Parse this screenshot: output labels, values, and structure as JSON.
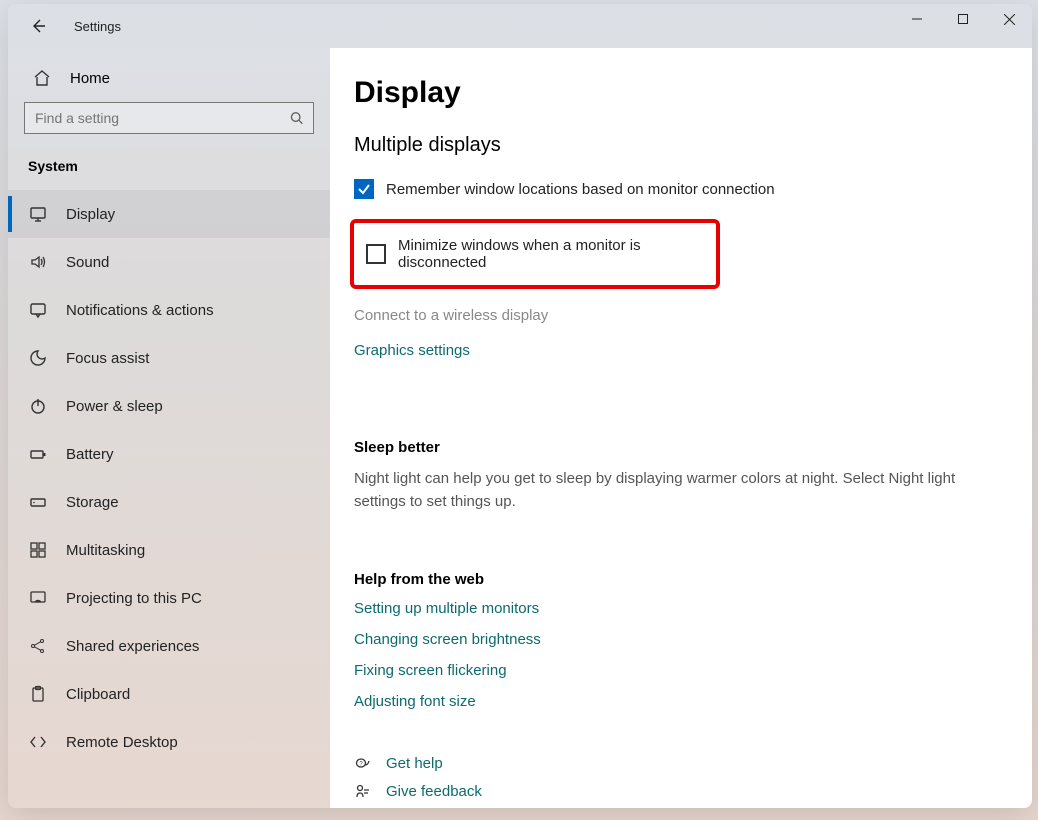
{
  "window": {
    "title": "Settings"
  },
  "home": {
    "label": "Home"
  },
  "search": {
    "placeholder": "Find a setting"
  },
  "category": "System",
  "sidebar": {
    "items": [
      {
        "label": "Display",
        "icon": "display-icon",
        "selected": true
      },
      {
        "label": "Sound",
        "icon": "sound-icon"
      },
      {
        "label": "Notifications & actions",
        "icon": "notifications-icon"
      },
      {
        "label": "Focus assist",
        "icon": "focus-assist-icon"
      },
      {
        "label": "Power & sleep",
        "icon": "power-icon"
      },
      {
        "label": "Battery",
        "icon": "battery-icon"
      },
      {
        "label": "Storage",
        "icon": "storage-icon"
      },
      {
        "label": "Multitasking",
        "icon": "multitasking-icon"
      },
      {
        "label": "Projecting to this PC",
        "icon": "projecting-icon"
      },
      {
        "label": "Shared experiences",
        "icon": "shared-icon"
      },
      {
        "label": "Clipboard",
        "icon": "clipboard-icon"
      },
      {
        "label": "Remote Desktop",
        "icon": "remote-icon"
      }
    ]
  },
  "page": {
    "title": "Display",
    "section_multiple": "Multiple displays",
    "cb_remember": "Remember window locations based on monitor connection",
    "cb_minimize": "Minimize windows when a monitor is disconnected",
    "link_wireless": "Connect to a wireless display",
    "link_graphics": "Graphics settings",
    "sleep_h": "Sleep better",
    "sleep_body": "Night light can help you get to sleep by displaying warmer colors at night. Select Night light settings to set things up.",
    "help_h": "Help from the web",
    "help_links": [
      "Setting up multiple monitors",
      "Changing screen brightness",
      "Fixing screen flickering",
      "Adjusting font size"
    ],
    "get_help": "Get help",
    "give_feedback": "Give feedback"
  }
}
